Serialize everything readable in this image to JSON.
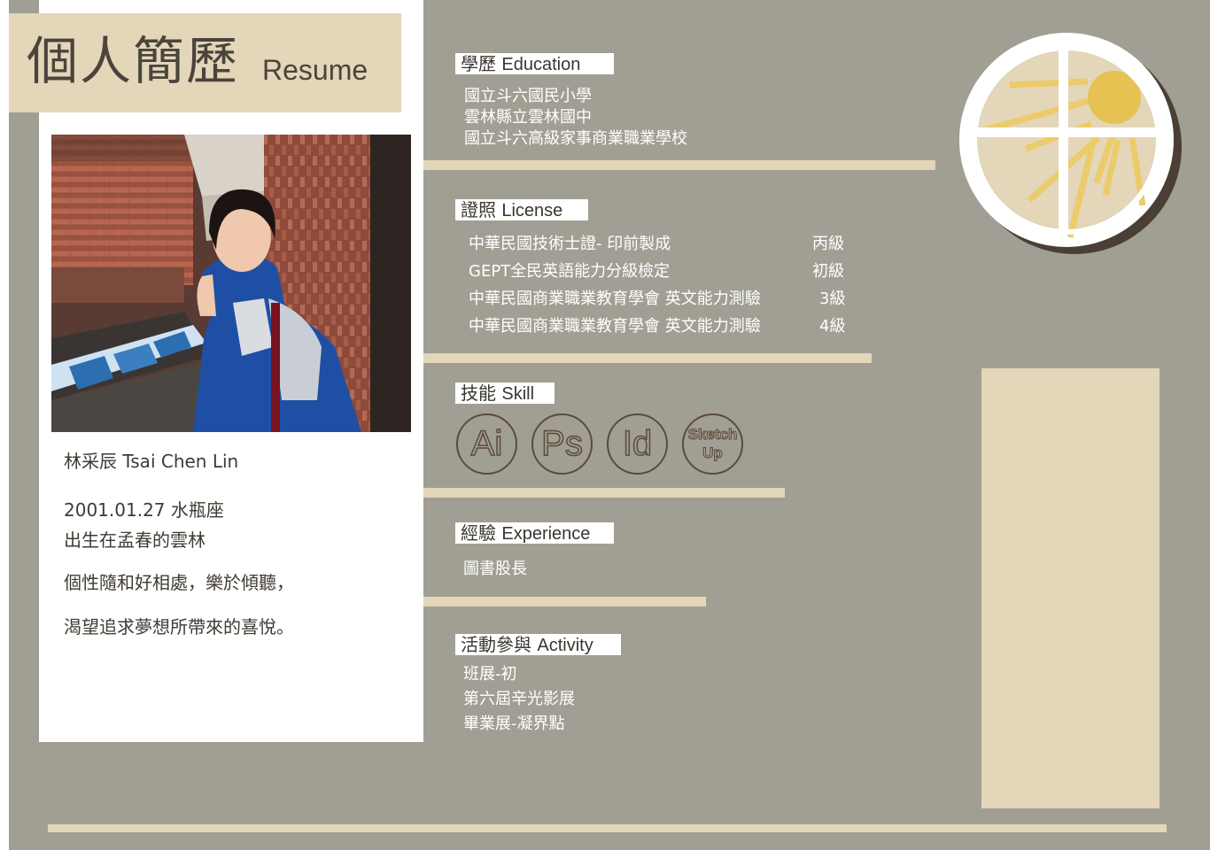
{
  "header": {
    "title_cn": "個人簡歷",
    "title_en": "Resume"
  },
  "profile": {
    "name": "林采辰  Tsai Chen Lin",
    "birth": "2001.01.27    水瓶座",
    "birthplace": "出生在孟春的雲林",
    "personality": "個性隨和好相處，樂於傾聽，",
    "aspiration": "渴望追求夢想所帶來的喜悅。"
  },
  "education": {
    "label_cn": "學歷",
    "label_en": "Education",
    "items": [
      "國立斗六國民小學",
      "雲林縣立雲林國中",
      "國立斗六高級家事商業職業學校"
    ]
  },
  "license": {
    "label_cn": "證照",
    "label_en": "License",
    "items": [
      {
        "name": "中華民國技術士證- 印前製成",
        "level": "丙級"
      },
      {
        "name": "GEPT全民英語能力分級檢定",
        "level": "初級"
      },
      {
        "name": "中華民國商業職業教育學會 英文能力測驗",
        "level": "3級"
      },
      {
        "name": "中華民國商業職業教育學會 英文能力測驗",
        "level": "4級"
      }
    ]
  },
  "skill": {
    "label_cn": "技能",
    "label_en": "Skill",
    "items": [
      "Ai",
      "Ps",
      "Id",
      "Sketch",
      "Up"
    ]
  },
  "experience": {
    "label_cn": "經驗",
    "label_en": "Experience",
    "items": [
      "圖書股長"
    ]
  },
  "activity": {
    "label_cn": "活動參與",
    "label_en": "Activity",
    "items": [
      "班展-初",
      "第六屆辛光影展",
      "畢業展-凝界點"
    ]
  },
  "colors": {
    "background": "#a19f93",
    "beige": "#e3d6b9",
    "panel": "#ffffff",
    "dark_brown": "#4a3f35",
    "sun": "#e6c253"
  },
  "icons": [
    "window-sun-icon"
  ]
}
